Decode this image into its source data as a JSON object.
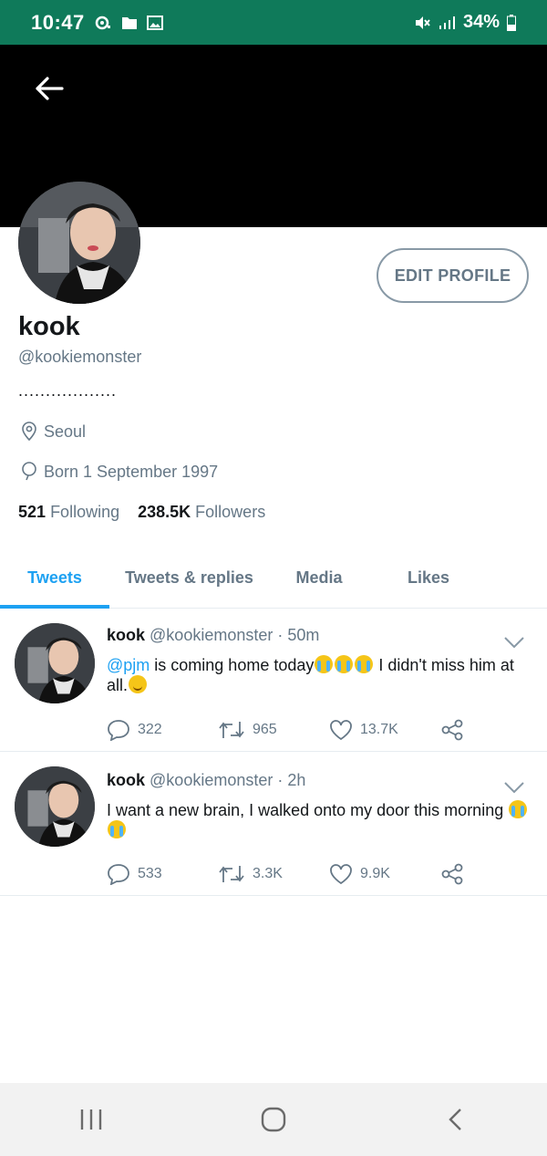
{
  "status_bar": {
    "time": "10:47",
    "battery": "34%"
  },
  "profile": {
    "display_name": "kook",
    "handle": "@kookiemonster",
    "bio": "..................",
    "location": "Seoul",
    "birthday": "Born 1 September 1997",
    "following_count": "521",
    "following_label": "Following",
    "followers_count": "238.5K",
    "followers_label": "Followers",
    "edit_label": "EDIT PROFILE"
  },
  "tabs": [
    {
      "label": "Tweets",
      "active": true
    },
    {
      "label": "Tweets & replies",
      "active": false
    },
    {
      "label": "Media",
      "active": false
    },
    {
      "label": "Likes",
      "active": false
    }
  ],
  "tweets": [
    {
      "name": "kook",
      "handle": "@kookiemonster",
      "time": "· 50m",
      "mention": "@pjm",
      "text_a": " is coming home today",
      "text_b": " I didn't miss him at all.",
      "replies": "322",
      "retweets": "965",
      "likes": "13.7K"
    },
    {
      "name": "kook",
      "handle": "@kookiemonster",
      "time": "· 2h",
      "text": "I want a new brain, I walked onto my door this morning ",
      "replies": "533",
      "retweets": "3.3K",
      "likes": "9.9K"
    }
  ],
  "colors": {
    "status_bar": "#0f7a5a",
    "accent": "#1da1f2",
    "secondary_text": "#657786"
  }
}
